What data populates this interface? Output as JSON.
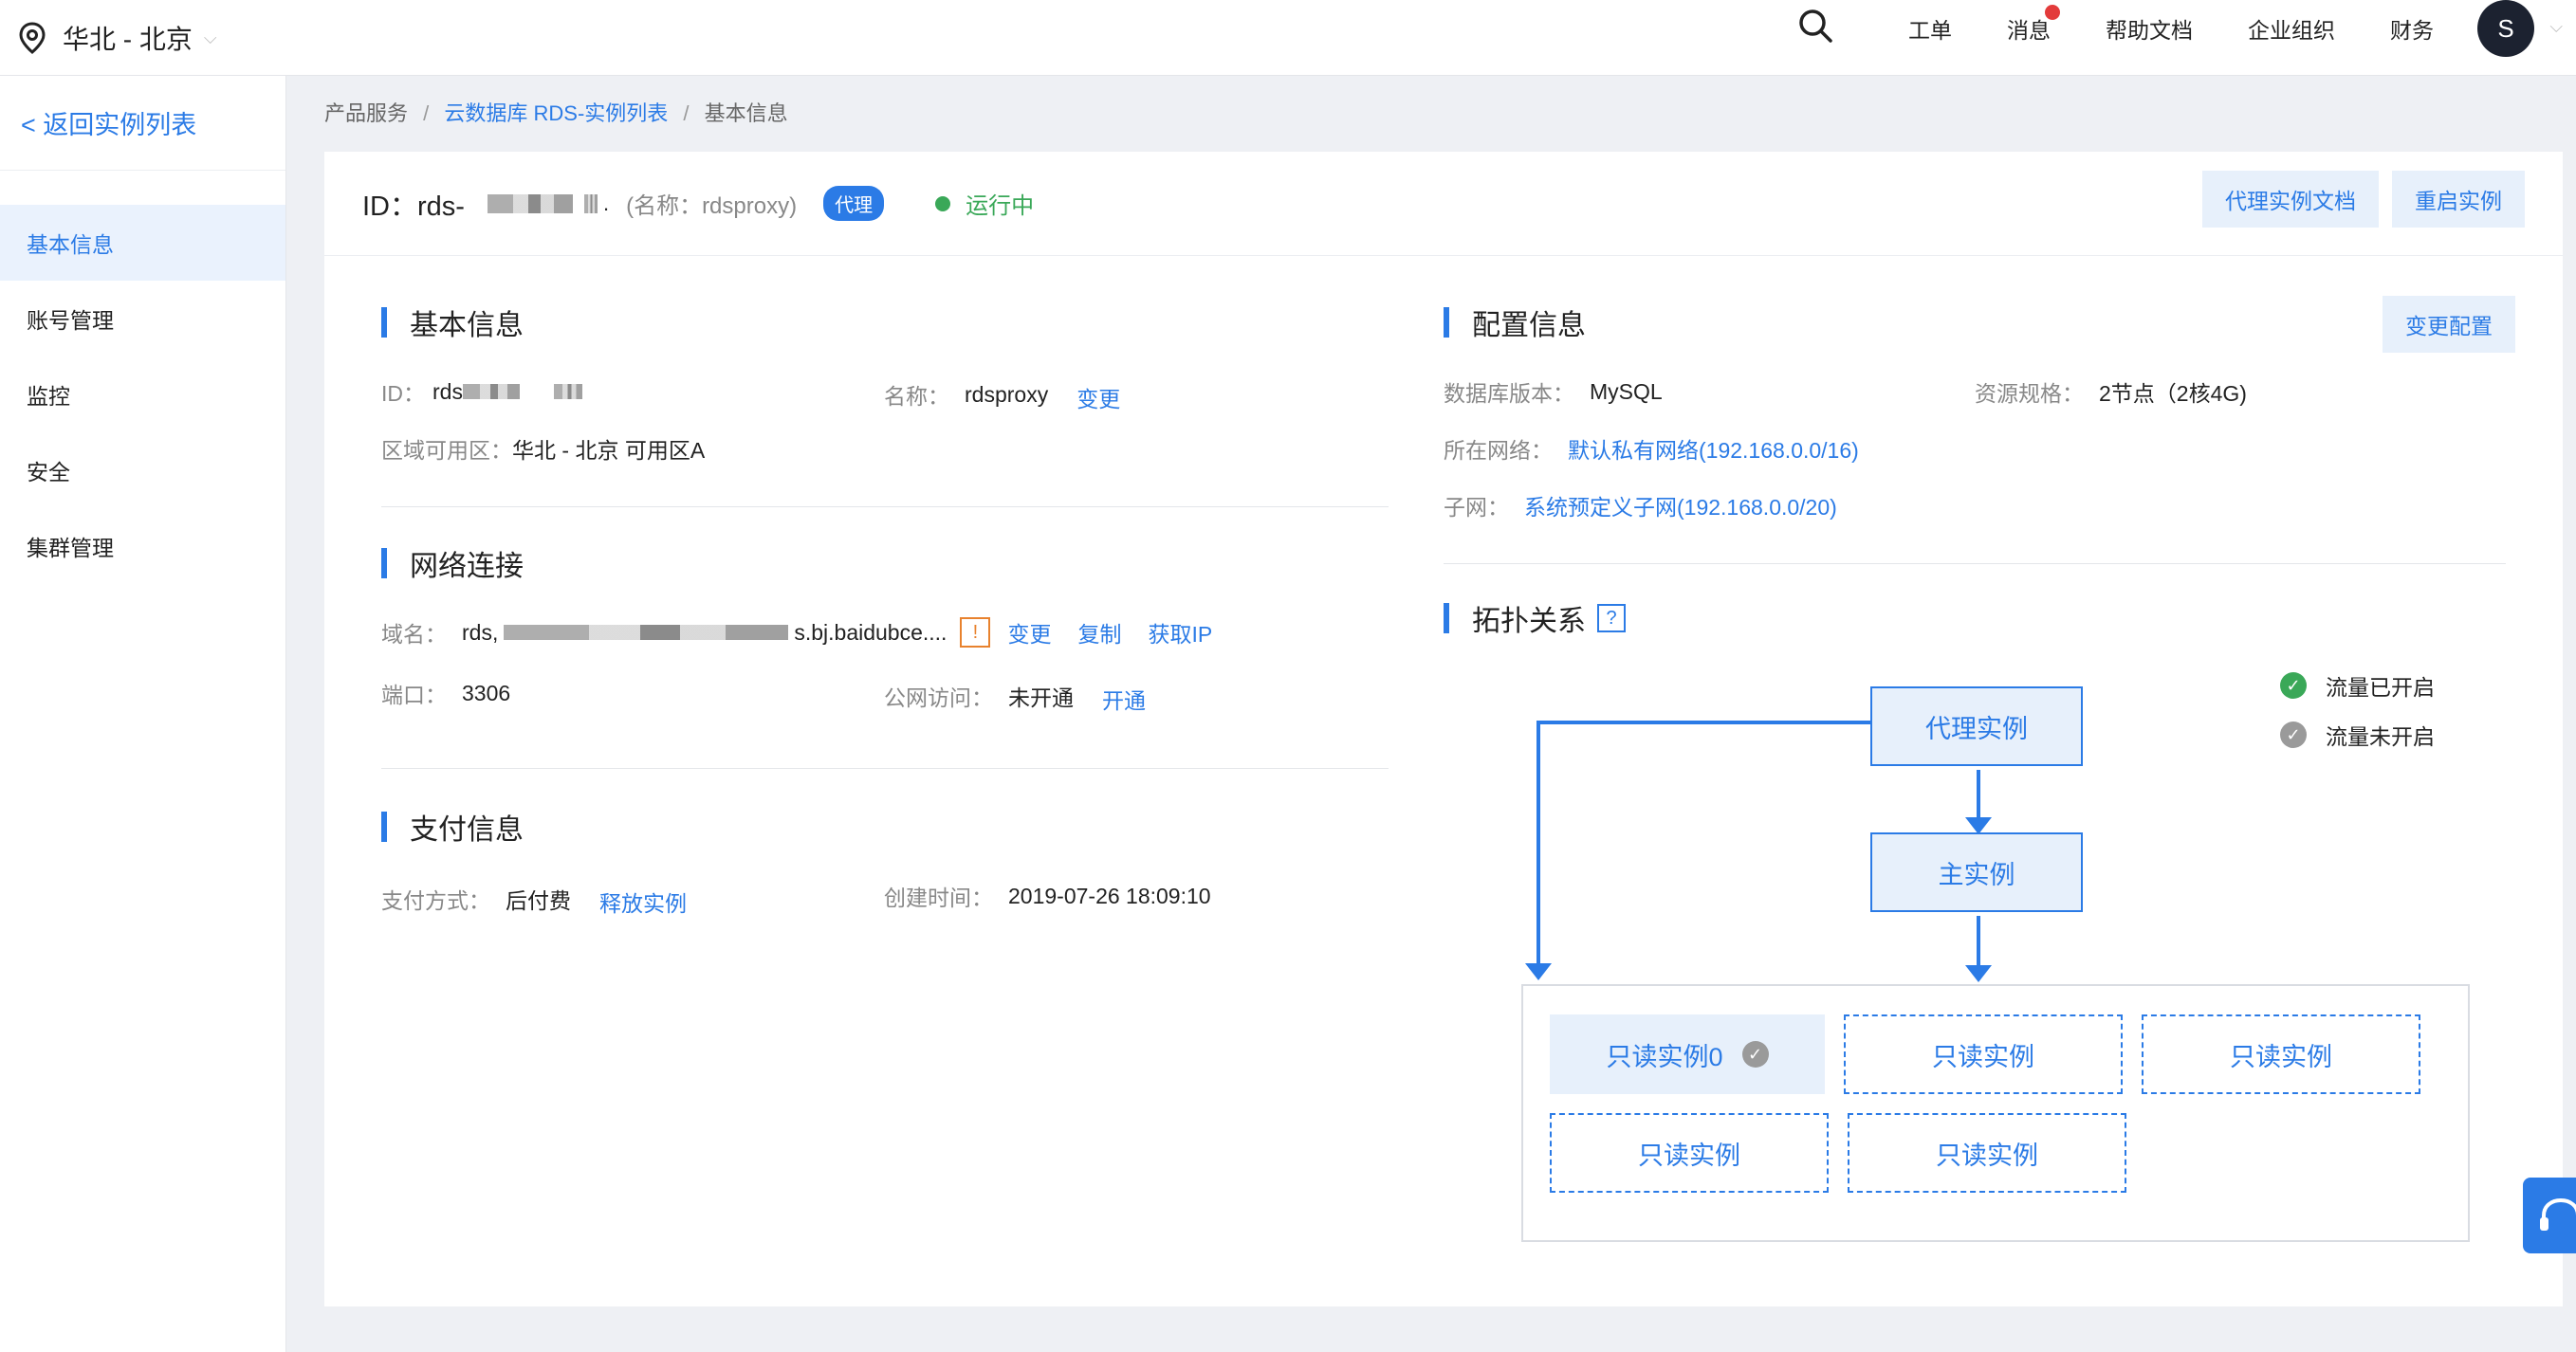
{
  "topbar": {
    "region": "华北 - 北京",
    "nav": [
      "工单",
      "消息",
      "帮助文档",
      "企业组织",
      "财务"
    ],
    "avatar": "S"
  },
  "sidebar": {
    "back": "< 返回实例列表",
    "items": [
      "基本信息",
      "账号管理",
      "监控",
      "安全",
      "集群管理"
    ]
  },
  "breadcrumb": {
    "root": "产品服务",
    "parent": "云数据库 RDS-实例列表",
    "current": "基本信息"
  },
  "header": {
    "id_label": "ID：rds-",
    "id_tail": ".",
    "name": "(名称：rdsproxy)",
    "tag": "代理",
    "status": "运行中",
    "btn_docs": "代理实例文档",
    "btn_restart": "重启实例"
  },
  "basic": {
    "title": "基本信息",
    "id_label": "ID：",
    "id_value": "rds",
    "name_label": "名称：",
    "name_value": "rdsproxy",
    "name_change": "变更",
    "zone_label": "区域可用区：",
    "zone_value": "华北 - 北京 可用区A"
  },
  "network": {
    "title": "网络连接",
    "domain_label": "域名：",
    "domain_prefix": "rds,",
    "domain_suffix": "s.bj.baidubce....",
    "warn": "!",
    "change": "变更",
    "copy": "复制",
    "get_ip": "获取IP",
    "port_label": "端口：",
    "port_value": "3306",
    "public_label": "公网访问：",
    "public_value": "未开通",
    "public_action": "开通"
  },
  "payment": {
    "title": "支付信息",
    "method_label": "支付方式：",
    "method_value": "后付费",
    "release": "释放实例",
    "created_label": "创建时间：",
    "created_value": "2019-07-26 18:09:10"
  },
  "config": {
    "title": "配置信息",
    "change_btn": "变更配置",
    "db_label": "数据库版本：",
    "db_value": "MySQL",
    "spec_label": "资源规格：",
    "spec_value": "2节点（2核4G)",
    "vpc_label": "所在网络：",
    "vpc_value": "默认私有网络(192.168.0.0/16)",
    "subnet_label": "子网：",
    "subnet_value": "系统预定义子网(192.168.0.0/20)"
  },
  "topology": {
    "title": "拓扑关系",
    "help": "?",
    "legend_on": "流量已开启",
    "legend_off": "流量未开启",
    "proxy": "代理实例",
    "master": "主实例",
    "readonly": [
      "只读实例0",
      "只读实例",
      "只读实例",
      "只读实例",
      "只读实例"
    ]
  },
  "colors": {
    "accent": "#2b7be6",
    "success": "#3aa858",
    "warning": "#e8822e",
    "badge": "#e33b3b"
  }
}
